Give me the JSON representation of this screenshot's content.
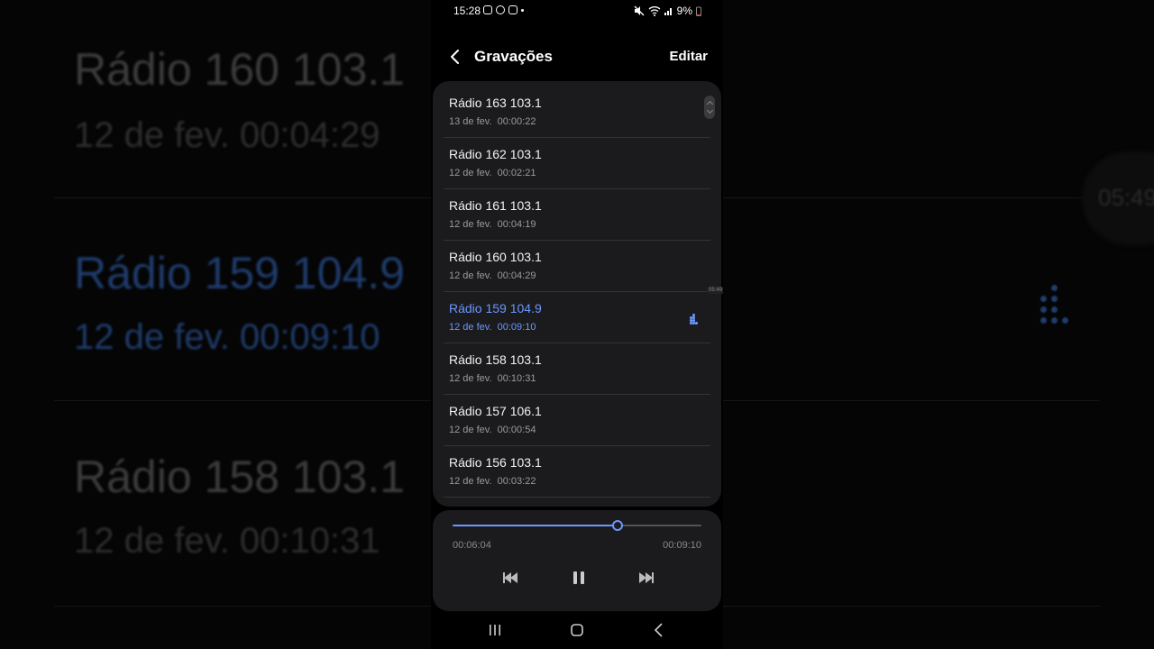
{
  "background": {
    "items": [
      {
        "title": "Rádio 160 103.1",
        "sub": "12 de fev.  00:04:29",
        "active": false
      },
      {
        "title": "Rádio 159 104.9",
        "sub": "12 de fev.  00:09:10",
        "active": true
      },
      {
        "title": "Rádio 158 103.1",
        "sub": "12 de fev.  00:10:31",
        "active": false
      }
    ],
    "time_label": "05:49"
  },
  "status_bar": {
    "time": "15:28",
    "battery": "9%"
  },
  "header": {
    "title": "Gravações",
    "edit_label": "Editar"
  },
  "recordings": [
    {
      "name": "Rádio 163 103.1",
      "date": "13 de fev.",
      "duration": "00:00:22",
      "active": false
    },
    {
      "name": "Rádio 162 103.1",
      "date": "12 de fev.",
      "duration": "00:02:21",
      "active": false
    },
    {
      "name": "Rádio 161 103.1",
      "date": "12 de fev.",
      "duration": "00:04:19",
      "active": false
    },
    {
      "name": "Rádio 160 103.1",
      "date": "12 de fev.",
      "duration": "00:04:29",
      "active": false
    },
    {
      "name": "Rádio 159 104.9",
      "date": "12 de fev.",
      "duration": "00:09:10",
      "active": true
    },
    {
      "name": "Rádio 158 103.1",
      "date": "12 de fev.",
      "duration": "00:10:31",
      "active": false
    },
    {
      "name": "Rádio 157 106.1",
      "date": "12 de fev.",
      "duration": "00:00:54",
      "active": false
    },
    {
      "name": "Rádio 156 103.1",
      "date": "12 de fev.",
      "duration": "00:03:22",
      "active": false
    }
  ],
  "side_tag": "05:49",
  "player": {
    "current_time": "00:06:04",
    "total_time": "00:09:10",
    "progress": 0.662
  },
  "colors": {
    "accent": "#6a97ff",
    "card": "#1b1b1d",
    "text": "#f2f2f2",
    "muted": "#9a9a9a"
  },
  "icons": {
    "back": "chevron-left-icon",
    "prev": "skip-previous-icon",
    "pause": "pause-icon",
    "next": "skip-next-icon",
    "playing": "waveform-icon",
    "nav_recents": "recents-icon",
    "nav_home": "home-icon",
    "nav_back": "back-icon"
  }
}
